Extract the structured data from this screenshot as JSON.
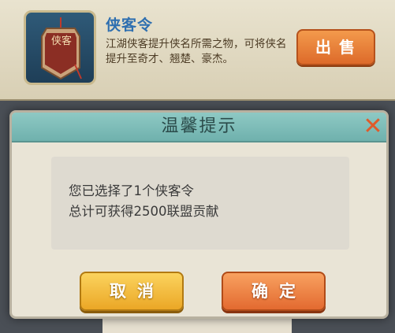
{
  "item_card": {
    "name": "侠客令",
    "icon_glyph": "侠客",
    "description": "江湖侠客提升侠名所需之物，可将侠名提升至奇才、翘楚、豪杰。",
    "sell_label": "出售"
  },
  "dialog": {
    "title": "温馨提示",
    "close_symbol": "✕",
    "message_line1": "您已选择了1个侠客令",
    "message_line2": "总计可获得2500联盟贡献",
    "cancel_label": "取消",
    "confirm_label": "确定"
  },
  "colors": {
    "header_teal": "#7dbdb8",
    "cancel_yellow": "#f2b83d",
    "confirm_orange": "#ec7f42",
    "item_name_blue": "#2e6fb0"
  }
}
